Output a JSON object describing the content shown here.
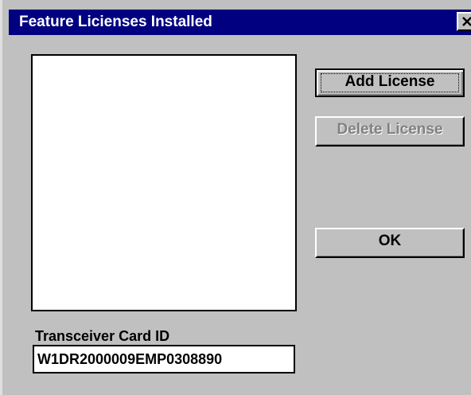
{
  "window": {
    "title": "Feature Licienses Installed",
    "close_icon": "close-icon"
  },
  "license_list": {
    "items": []
  },
  "buttons": {
    "add_license": "Add License",
    "delete_license": "Delete License",
    "ok": "OK"
  },
  "transceiver": {
    "label": "Transceiver Card ID",
    "value": "W1DR2000009EMP0308890"
  },
  "colors": {
    "titlebar": "#000080",
    "dialog_background": "#c0c0c0",
    "disabled_text": "#808080"
  }
}
